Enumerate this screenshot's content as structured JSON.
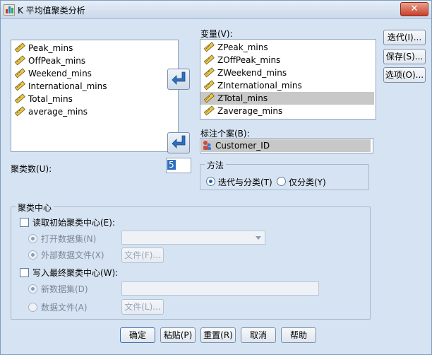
{
  "window": {
    "title": "K 平均值聚类分析",
    "close_glyph": "✕"
  },
  "source_list": {
    "items": [
      "Peak_mins",
      "OffPeak_mins",
      "Weekend_mins",
      "International_mins",
      "Total_mins",
      "average_mins"
    ]
  },
  "variables": {
    "label": "变量(V):",
    "items": [
      "ZPeak_mins",
      "ZOffPeak_mins",
      "ZWeekend_mins",
      "ZInternational_mins",
      "ZTotal_mins",
      "Zaverage_mins"
    ],
    "selected_index": 4
  },
  "case_label": {
    "label": "标注个案(B):",
    "value": "Customer_ID"
  },
  "num_clusters": {
    "label": "聚类数(U):",
    "value": "5"
  },
  "method": {
    "title": "方法",
    "options": [
      "迭代与分类(T)",
      "仅分类(Y)"
    ],
    "selected": "迭代与分类(T)"
  },
  "cluster_centers": {
    "title": "聚类中心",
    "read_initial": {
      "label": "读取初始聚类中心(E):",
      "checked": false
    },
    "open_dataset": "打开数据集(N)",
    "external_file": "外部数据文件(X)",
    "file_button_1": "文件(F)...",
    "write_final": {
      "label": "写入最终聚类中心(W):",
      "checked": false
    },
    "new_dataset": "新数据集(D)",
    "data_file": "数据文件(A)",
    "file_button_2": "文件(L)..."
  },
  "side_buttons": [
    "迭代(I)...",
    "保存(S)...",
    "选项(O)..."
  ],
  "bottom_buttons": [
    "确定",
    "粘贴(P)",
    "重置(R)",
    "取消",
    "帮助"
  ],
  "colors": {
    "window_bg": "#d6e3f2",
    "selection": "#c8c8c8",
    "radio_dot": "#1f5fbf"
  },
  "icons": {
    "move_arrow": "arrow-right-icon",
    "scale_variable": "ruler-icon",
    "nominal_variable": "nominal-person-icon"
  }
}
